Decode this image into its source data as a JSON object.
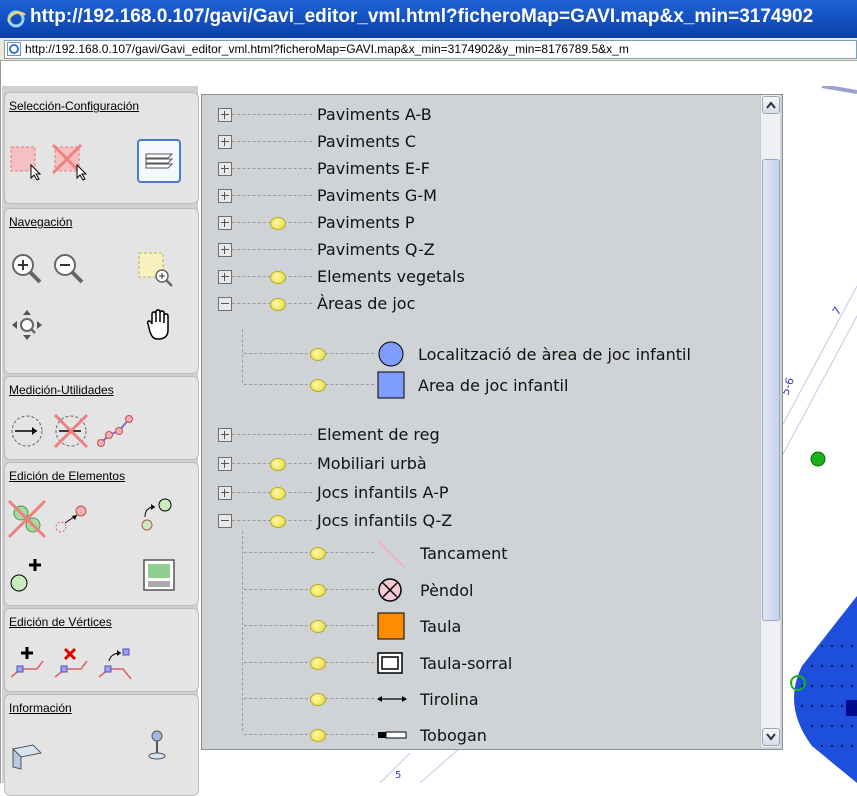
{
  "window": {
    "title": "http://192.168.0.107/gavi/Gavi_editor_vml.html?ficheroMap=GAVI.map&x_min=3174902",
    "address": "http://192.168.0.107/gavi/Gavi_editor_vml.html?ficheroMap=GAVI.map&x_min=3174902&y_min=8176789.5&x_m"
  },
  "tools": {
    "groups": [
      {
        "title": "Selección-Configuración"
      },
      {
        "title": "Navegación"
      },
      {
        "title": "Medición-Utilidades"
      },
      {
        "title": "Edición de Elementos"
      },
      {
        "title": "Edición de Vértices"
      },
      {
        "title": "Información"
      }
    ]
  },
  "legend": {
    "items": [
      {
        "label": "Paviments A-B"
      },
      {
        "label": "Paviments C"
      },
      {
        "label": "Paviments E-F"
      },
      {
        "label": "Paviments G-M"
      },
      {
        "label": "Paviments P"
      },
      {
        "label": "Paviments Q-Z"
      },
      {
        "label": "Elements vegetals"
      },
      {
        "label": "Àreas de joc"
      },
      {
        "label": "Localització de àrea de joc infantil"
      },
      {
        "label": "Area de joc infantil"
      },
      {
        "label": "Element de reg"
      },
      {
        "label": "Mobiliari urbà"
      },
      {
        "label": "Jocs infantils A-P"
      },
      {
        "label": "Jocs infantils Q-Z"
      },
      {
        "label": "Tancament"
      },
      {
        "label": "Pèndol"
      },
      {
        "label": "Taula"
      },
      {
        "label": "Taula-sorral"
      },
      {
        "label": "Tirolina"
      },
      {
        "label": "Tobogan"
      }
    ]
  },
  "map": {
    "labels": [
      "7",
      "5-6",
      "5"
    ]
  },
  "colors": {
    "orange": "#ff8c00",
    "blue_symbol": "#7f9dff",
    "map_blue": "#1e4fdc",
    "map_green": "#19b219"
  }
}
